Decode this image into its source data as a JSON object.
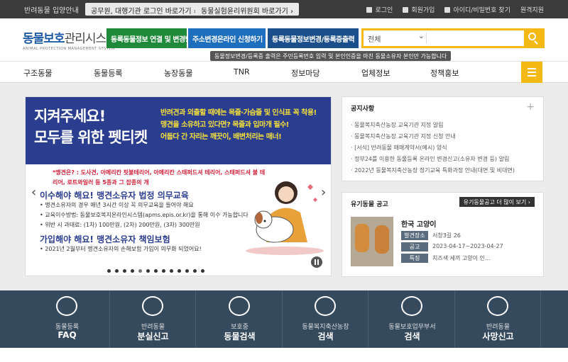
{
  "topbar": {
    "intro": "반려동물 입양안내",
    "pill1": "공무원, 대행기관 로그인 바로가기 ›",
    "pill2": "동물실험윤리위원회 바로가기 ›",
    "login": "로그인",
    "join": "회원가입",
    "find": "아이디/비밀번호 찾기",
    "remote": "원격지원"
  },
  "logo": {
    "main": "동물보호",
    "sub": "관리시스템",
    "en": "ANIMAL PROTECTION MANAGEMENT SYSTEM"
  },
  "header": {
    "btn1": "동록동물정보 연결 및 변경방법",
    "btn2": "주소변경온라인 신청하기",
    "btn3": "등록동물정보변경/등록증출력",
    "search_select": "전체",
    "tip": "동물정보변경/등록증 출력은 주민등록번호 입력 및 본인인증을 마친 동물소유자 본인만 가능합니다"
  },
  "nav": [
    "구조동물",
    "동물등록",
    "농장동물",
    "TNR",
    "정보마당",
    "업체정보",
    "정책홍보"
  ],
  "banner": {
    "title1": "지켜주세요!",
    "title2": "모두를 위한 펫티켓",
    "msg1": "반려견과 외출할 때에는 목줄·가슴줄 및 인식표 꼭 착용!",
    "msg2": "맹견을 소유하고 있다면? 목줄과 입마개 필수!",
    "msg3": "어둡다 간 자리는 깨끗이, 배변처리는 매너!",
    "note": "*맹견은? : 도사견, 아메리칸 핏불테리어, 아메리칸 스태퍼드셔 테리어, 스태퍼드셔 불 테리어, 로트와일러 등 5종과 그 잡종의 개",
    "h1": "이수해야 해요! 맹견소유자 법정 의무교육",
    "b1": "• 맹견소유자의 경우 매년 3시간 이상 꼭 의무교육을 들어야 해요",
    "b2": "• 교육이수방법: 동물보호복지온라인시스템(apms.epis.or.kr)을 통해 이수 가능합니다",
    "b3": "• 위반 시 과태료: (1차) 100만원, (2차) 200만원, (3차) 300만원",
    "h2": "가입해야 해요! 맹견소유자 책임보험",
    "b4": "• 2021년 2월부터 맹견소유자의 손해보험 가입이 의무화 되었어요!"
  },
  "notice": {
    "title": "공지사항",
    "items": [
      "동물복지축산농장 교육기관 지정 알림",
      "동물복지축산농장 교육기관 지정 신청 안내",
      "[서식] 반려동물 매매계약서(예시) 양식",
      "정부24를 이용한 동물등록 온라인 변경신고(소유자 변경 등) 알림",
      "2022년 동물복지축산농장 정기교육 특화과정 안내(대면 및 비대면)"
    ]
  },
  "lost": {
    "title": "유기동물 공고",
    "more": "유기동물공고 더 많이 보기 ›",
    "animal": "한국 고양이",
    "rows": [
      {
        "label": "발견장소",
        "value": "서창3길 26"
      },
      {
        "label": "공고",
        "value": "2023-04-17~2023-04-27"
      },
      {
        "label": "특징",
        "value": "치즈색 세끼 고양이 인..."
      }
    ]
  },
  "quick": [
    {
      "sub": "동물등록",
      "main": "FAQ",
      "icon": "chat-icon"
    },
    {
      "sub": "반려동물",
      "main": "분실신고",
      "icon": "collar-icon"
    },
    {
      "sub": "보호중",
      "main": "동물검색",
      "icon": "dog-icon"
    },
    {
      "sub": "동물복지축산농장",
      "main": "검색",
      "icon": "plant-hand-icon"
    },
    {
      "sub": "동물보호업무부서",
      "main": "검색",
      "icon": "document-search-icon"
    },
    {
      "sub": "반려동물",
      "main": "사망신고",
      "icon": "flower-icon"
    }
  ]
}
